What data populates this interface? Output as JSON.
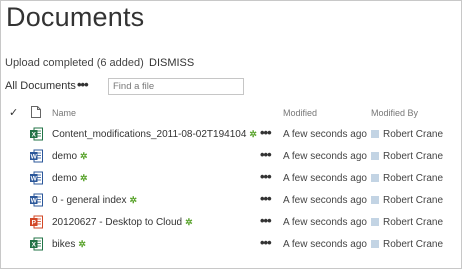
{
  "page": {
    "title": "Documents",
    "upload_status": "Upload completed (6 added)",
    "dismiss_label": "DISMISS",
    "view_name": "All Documents",
    "view_more": "•••",
    "search_placeholder": "Find a file"
  },
  "columns": {
    "check": "✓",
    "name": "Name",
    "modified": "Modified",
    "modified_by": "Modified By"
  },
  "colors": {
    "word": "#2b579a",
    "excel": "#217346",
    "powerpoint": "#d24726",
    "new_marker": "#59a32c"
  },
  "files": [
    {
      "name": "Content_modifications_2011-08-02T194104",
      "icon": "excel-icon",
      "type_letter": "X",
      "new_marker": "✲",
      "more": "•••",
      "modified": "A few seconds ago",
      "modified_by": "Robert Crane"
    },
    {
      "name": "demo",
      "icon": "word-icon",
      "type_letter": "W",
      "new_marker": "✲",
      "more": "•••",
      "modified": "A few seconds ago",
      "modified_by": "Robert Crane"
    },
    {
      "name": "demo",
      "icon": "word-icon",
      "type_letter": "W",
      "new_marker": "✲",
      "more": "•••",
      "modified": "A few seconds ago",
      "modified_by": "Robert Crane"
    },
    {
      "name": "0 - general index",
      "icon": "word-icon",
      "type_letter": "W",
      "new_marker": "✲",
      "more": "•••",
      "modified": "A few seconds ago",
      "modified_by": "Robert Crane"
    },
    {
      "name": "20120627 - Desktop to Cloud",
      "icon": "powerpoint-icon",
      "type_letter": "P",
      "new_marker": "✲",
      "more": "•••",
      "modified": "A few seconds ago",
      "modified_by": "Robert Crane"
    },
    {
      "name": "bikes",
      "icon": "excel-icon",
      "type_letter": "X",
      "new_marker": "✲",
      "more": "•••",
      "modified": "A few seconds ago",
      "modified_by": "Robert Crane"
    }
  ]
}
